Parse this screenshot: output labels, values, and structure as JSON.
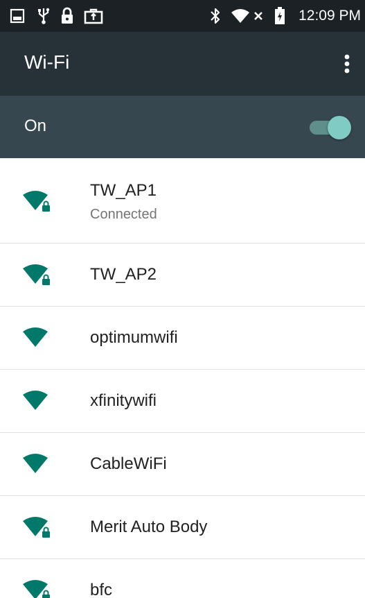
{
  "status_bar": {
    "time": "12:09 PM",
    "icons": [
      "gallery-icon",
      "usb-icon",
      "lock-icon",
      "briefcase-icon",
      "bluetooth-icon",
      "wifi-icon",
      "signal-off-icon",
      "battery-charging-icon"
    ]
  },
  "app_bar": {
    "title": "Wi-Fi",
    "overflow_icon": "more-vert-icon"
  },
  "switch_bar": {
    "label": "On",
    "state": "on"
  },
  "networks": [
    {
      "ssid": "TW_AP1",
      "summary": "Connected",
      "secured": true
    },
    {
      "ssid": "TW_AP2",
      "summary": "",
      "secured": true
    },
    {
      "ssid": "optimumwifi",
      "summary": "",
      "secured": false
    },
    {
      "ssid": "xfinitywifi",
      "summary": "",
      "secured": false
    },
    {
      "ssid": "CableWiFi",
      "summary": "",
      "secured": false
    },
    {
      "ssid": "Merit Auto Body",
      "summary": "",
      "secured": true
    },
    {
      "ssid": "bfc",
      "summary": "",
      "secured": true
    }
  ],
  "colors": {
    "status_bar_bg": "#1b2124",
    "app_bar_bg": "#263238",
    "switch_bar_bg": "#37474f",
    "accent": "#80cbc4",
    "wifi_icon": "#00796b"
  }
}
